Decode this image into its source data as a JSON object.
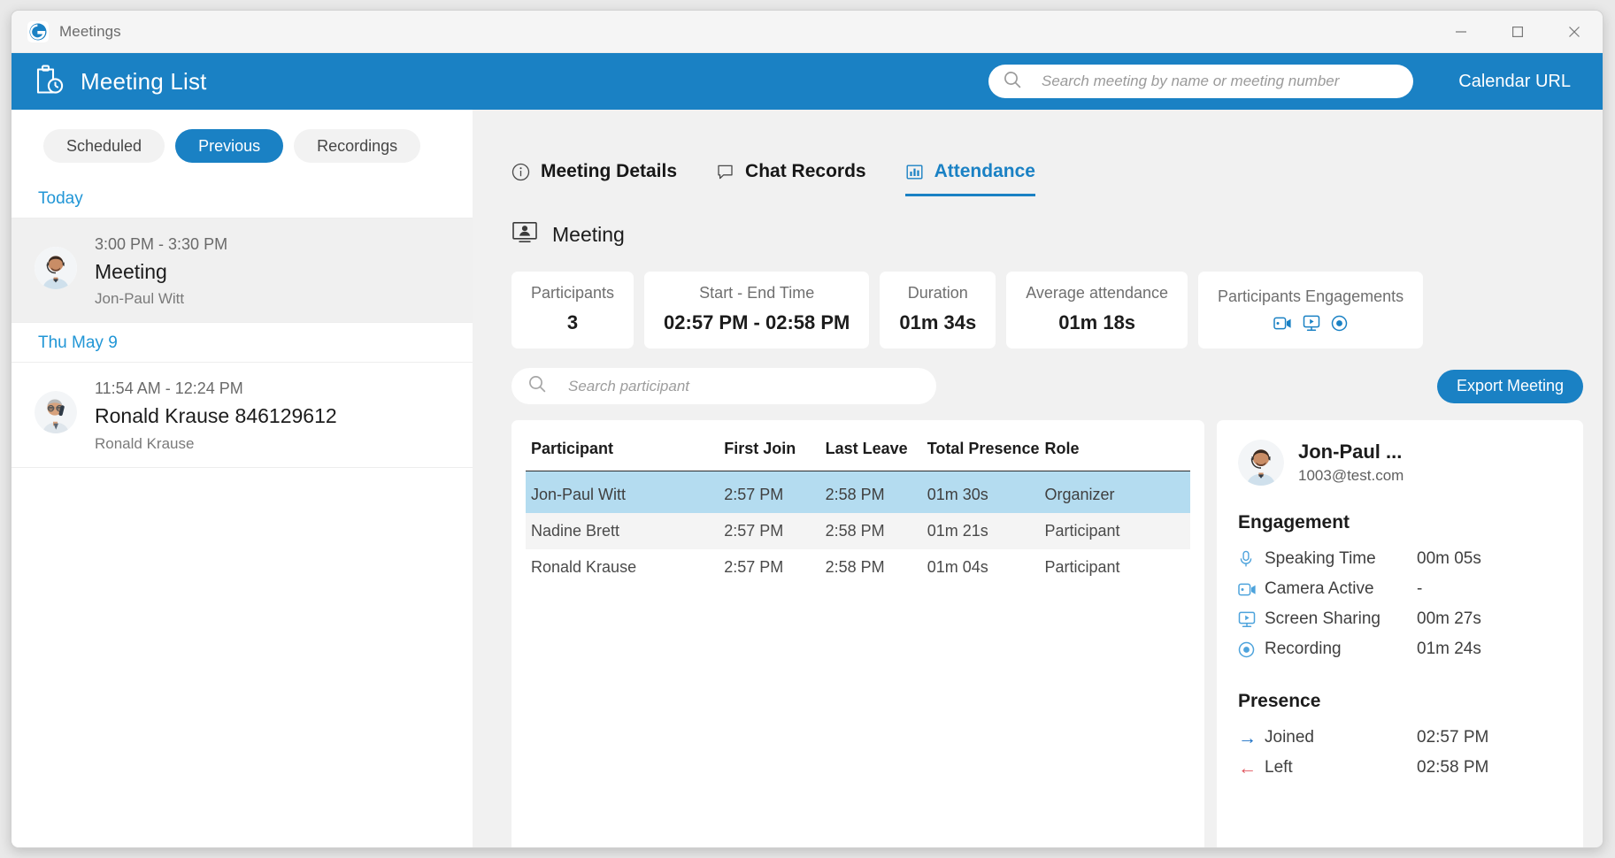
{
  "window": {
    "titlebar_title": "Meetings",
    "app_icon": "g-logo-icon",
    "minimize_label": "—",
    "maximize_label": "□",
    "close_label": "✕"
  },
  "header": {
    "title": "Meeting List",
    "icon": "clipboard-clock-icon",
    "search_placeholder": "Search meeting by name or meeting number",
    "search_value": "",
    "search_icon": "search-icon",
    "calendar_url_label": "Calendar URL",
    "background_color": "#1a81c4"
  },
  "sidebar": {
    "filters": [
      {
        "label": "Scheduled",
        "active": false
      },
      {
        "label": "Previous",
        "active": true
      },
      {
        "label": "Recordings",
        "active": false
      }
    ],
    "groups": [
      {
        "date_label": "Today",
        "meetings": [
          {
            "time": "3:00 PM - 3:30 PM",
            "title": "Meeting",
            "host": "Jon-Paul Witt",
            "selected": true,
            "avatar": "avatar-man-headset"
          }
        ]
      },
      {
        "date_label": "Thu May 9",
        "meetings": [
          {
            "time": "11:54 AM - 12:24 PM",
            "title": "Ronald Krause 846129612",
            "host": "Ronald Krause",
            "selected": false,
            "avatar": "avatar-man-phone"
          }
        ]
      }
    ]
  },
  "main": {
    "tabs": [
      {
        "label": "Meeting Details",
        "icon": "info-circle-icon",
        "active": false
      },
      {
        "label": "Chat Records",
        "icon": "chat-bubble-icon",
        "active": false
      },
      {
        "label": "Attendance",
        "icon": "bar-chart-icon",
        "active": true
      }
    ],
    "meeting_heading": {
      "label": "Meeting",
      "icon": "presentation-person-icon"
    },
    "stats": [
      {
        "label": "Participants",
        "value": "3"
      },
      {
        "label": "Start - End Time",
        "value": "02:57 PM - 02:58 PM"
      },
      {
        "label": "Duration",
        "value": "01m 34s"
      },
      {
        "label": "Average attendance",
        "value": "01m 18s"
      },
      {
        "label": "Participants Engagements",
        "value": "",
        "icons": [
          "camera-icon",
          "screen-share-icon",
          "record-icon"
        ]
      }
    ],
    "participant_search": {
      "placeholder": "Search participant",
      "value": "",
      "icon": "search-icon"
    },
    "export_button_label": "Export Meeting",
    "table": {
      "columns": [
        "Participant",
        "First Join",
        "Last Leave",
        "Total Presence",
        "Role"
      ],
      "rows": [
        {
          "participant": "Jon-Paul Witt",
          "first_join": "2:57 PM",
          "last_leave": "2:58 PM",
          "total_presence": "01m 30s",
          "role": "Organizer",
          "selected": true
        },
        {
          "participant": "Nadine Brett",
          "first_join": "2:57 PM",
          "last_leave": "2:58 PM",
          "total_presence": "01m 21s",
          "role": "Participant",
          "selected": false
        },
        {
          "participant": "Ronald Krause",
          "first_join": "2:57 PM",
          "last_leave": "2:58 PM",
          "total_presence": "01m 04s",
          "role": "Participant",
          "selected": false
        }
      ]
    },
    "detail": {
      "name": "Jon-Paul ...",
      "email": "1003@test.com",
      "avatar": "avatar-man-headset",
      "engagement_title": "Engagement",
      "engagement": [
        {
          "icon": "microphone-icon",
          "label": "Speaking Time",
          "value": "00m 05s"
        },
        {
          "icon": "camera-icon",
          "label": "Camera Active",
          "value": "-"
        },
        {
          "icon": "screen-share-icon",
          "label": "Screen Sharing",
          "value": "00m 27s"
        },
        {
          "icon": "record-icon",
          "label": "Recording",
          "value": "01m 24s"
        }
      ],
      "presence_title": "Presence",
      "presence": [
        {
          "icon": "arrow-right-icon",
          "label": "Joined",
          "value": "02:57 PM"
        },
        {
          "icon": "arrow-left-icon",
          "label": "Left",
          "value": "02:58 PM"
        }
      ]
    }
  },
  "colors": {
    "accent": "#1a81c4",
    "link": "#2196d6",
    "row_selected": "#b4dcf0",
    "joined_arrow": "#1a6fc4",
    "left_arrow": "#e0575f"
  }
}
